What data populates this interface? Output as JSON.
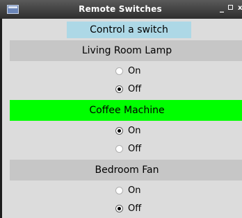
{
  "window": {
    "title": "Remote Switches",
    "controls": {
      "minimize": "_",
      "close": "x"
    }
  },
  "header": {
    "label": "Control a switch"
  },
  "switches": [
    {
      "name": "Living Room Lamp",
      "active": false,
      "options": [
        {
          "label": "On",
          "selected": false
        },
        {
          "label": "Off",
          "selected": true
        }
      ]
    },
    {
      "name": "Coffee Machine",
      "active": true,
      "options": [
        {
          "label": "On",
          "selected": true
        },
        {
          "label": "Off",
          "selected": false
        }
      ]
    },
    {
      "name": "Bedroom Fan",
      "active": false,
      "options": [
        {
          "label": "On",
          "selected": false
        },
        {
          "label": "Off",
          "selected": true
        }
      ]
    }
  ],
  "colors": {
    "header_bg": "#add8e6",
    "active_bg": "#00ff00",
    "inactive_bg": "#c6c6c6"
  }
}
